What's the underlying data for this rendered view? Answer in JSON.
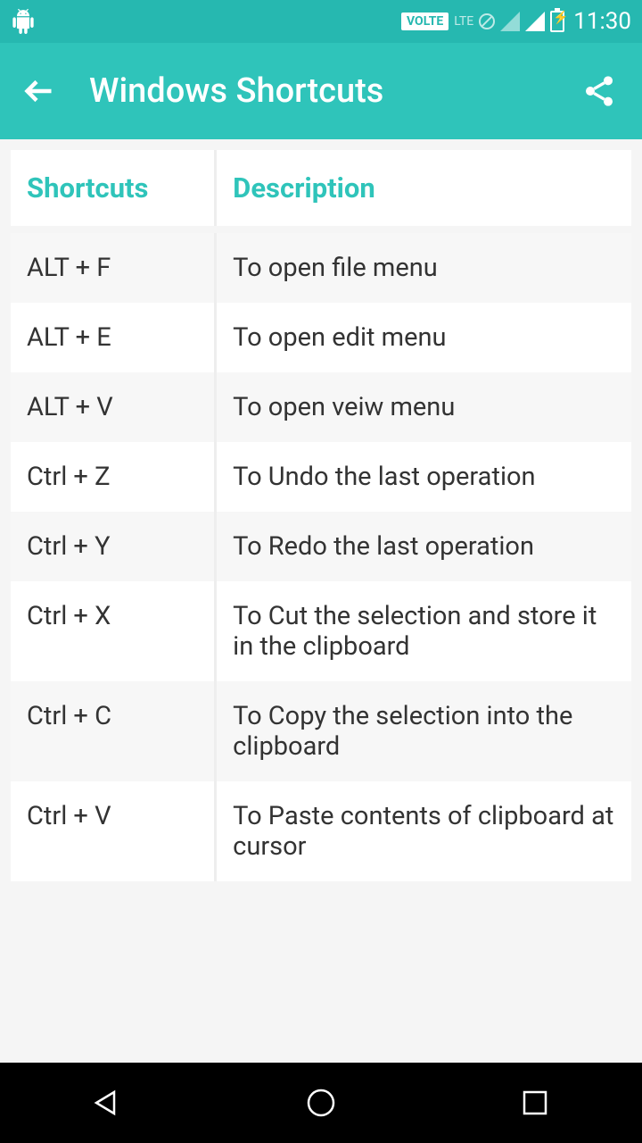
{
  "status": {
    "volte": "VOLTE",
    "lte": "LTE",
    "time": "11:30"
  },
  "appbar": {
    "title": "Windows Shortcuts"
  },
  "table": {
    "headers": {
      "shortcuts": "Shortcuts",
      "description": "Description"
    },
    "rows": [
      {
        "shortcut": "ALT + F",
        "description": "To open file menu"
      },
      {
        "shortcut": "ALT + E",
        "description": "To open edit menu"
      },
      {
        "shortcut": "ALT + V",
        "description": "To open veiw menu"
      },
      {
        "shortcut": "Ctrl + Z",
        "description": "To Undo the last operation"
      },
      {
        "shortcut": "Ctrl + Y",
        "description": "To Redo the last operation"
      },
      {
        "shortcut": "Ctrl + X",
        "description": "To Cut the selection and store it in the clipboard"
      },
      {
        "shortcut": "Ctrl + C",
        "description": "To Copy the selection into the clipboard"
      },
      {
        "shortcut": "Ctrl + V",
        "description": "To Paste contents of clipboard at cursor"
      }
    ]
  }
}
